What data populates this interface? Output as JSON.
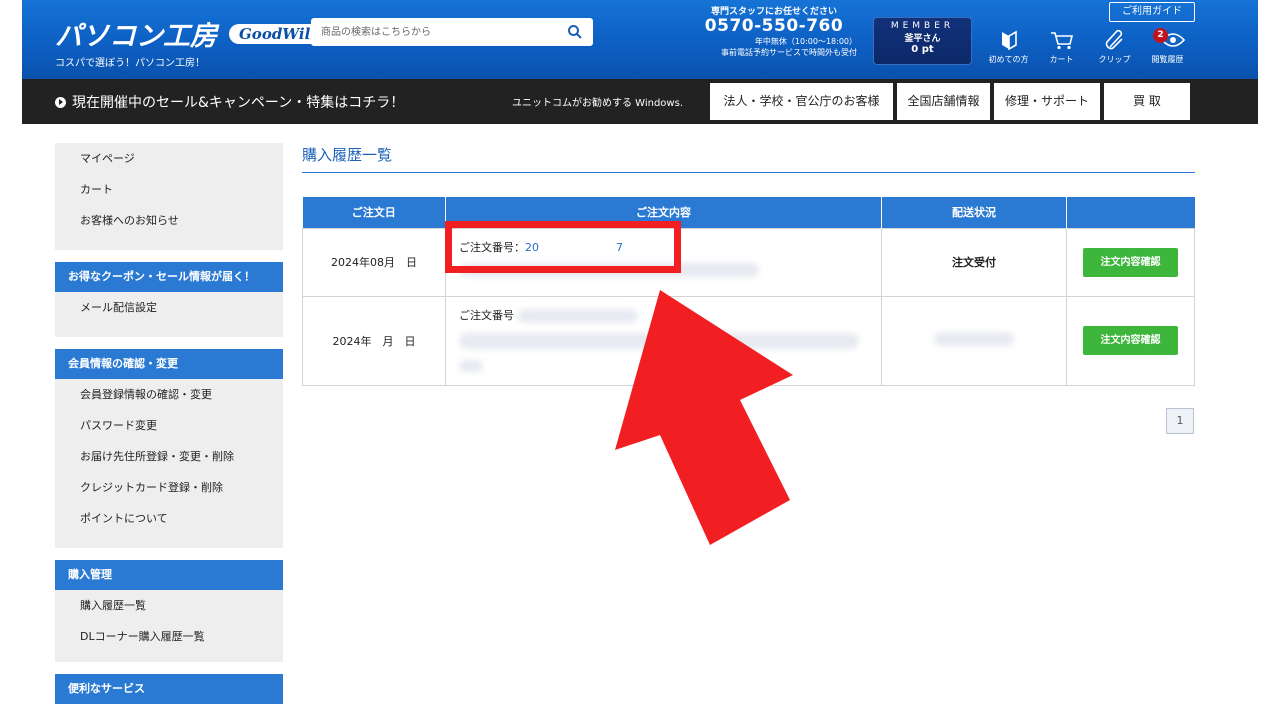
{
  "header": {
    "logo": "パソコン工房",
    "logo_badge": "GoodWill",
    "tagline": "コスパで選ぼう！パソコン工房！",
    "search_placeholder": "商品の検索はこちらから",
    "contact": {
      "line1": "専門スタッフにお任せください",
      "phone": "0570-550-760",
      "line2": "年中無休（10:00～18:00）",
      "line3": "事前電話予約サービスで時間外も受付"
    },
    "member": {
      "label": "MEMBER",
      "name": "釜平さん",
      "points": "0 pt"
    },
    "guide": "ご利用ガイド",
    "icons": [
      {
        "label": "初めての方"
      },
      {
        "label": "カート"
      },
      {
        "label": "クリップ"
      },
      {
        "label": "閲覧履歴",
        "badge": "2"
      }
    ]
  },
  "nav": {
    "campaign": "現在開催中のセール&キャンペーン・特集はコチラ！",
    "windows": "ユニットコムがお勧めする Windows.",
    "buttons": [
      "法人・学校・官公庁のお客様",
      "全国店舗情報",
      "修理・サポート",
      "買 取"
    ]
  },
  "sidebar": {
    "block1": [
      "マイページ",
      "カート",
      "お客様へのお知らせ"
    ],
    "block2": {
      "head": "お得なクーポン・セール情報が届く！",
      "items": [
        "メール配信設定"
      ]
    },
    "block3": {
      "head": "会員情報の確認・変更",
      "items": [
        "会員登録情報の確認・変更",
        "パスワード変更",
        "お届け先住所登録・変更・削除",
        "クレジットカード登録・削除",
        "ポイントについて"
      ]
    },
    "block4": {
      "head": "購入管理",
      "items": [
        "購入履歴一覧",
        "DLコーナー購入履歴一覧"
      ]
    },
    "block5": {
      "head": "便利なサービス"
    }
  },
  "main": {
    "title": "購入履歴一覧",
    "columns": [
      "ご注文日",
      "ご注文内容",
      "配送状況",
      ""
    ],
    "rows": [
      {
        "date": "2024年08月　日",
        "order_label": "ご注文番号：",
        "order_num": "20　　　　　　　7",
        "status": "注文受付",
        "button": "注文内容確認"
      },
      {
        "date": "2024年　月　日",
        "order_label": "ご注文番号",
        "order_num": "",
        "status": "",
        "button": "注文内容確認"
      }
    ],
    "page": "1"
  },
  "colors": {
    "header_blue": "#0d5fc3",
    "accent_blue": "#2a7ad4",
    "button_green": "#3db63b",
    "highlight_red": "#f21f22"
  }
}
